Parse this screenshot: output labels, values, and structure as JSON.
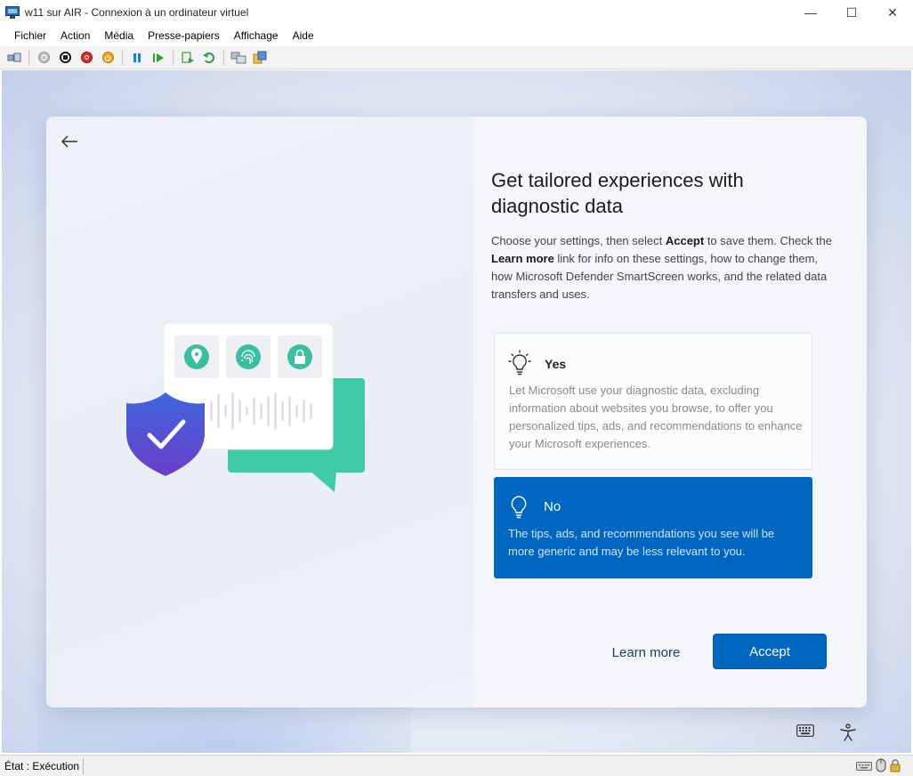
{
  "window": {
    "title": "w11 sur AIR - Connexion à un ordinateur virtuel",
    "minimize_glyph": "—",
    "maximize_glyph": "☐",
    "close_glyph": "✕"
  },
  "menubar": {
    "items": [
      {
        "label": "Fichier"
      },
      {
        "label": "Action"
      },
      {
        "label": "Média"
      },
      {
        "label": "Presse-papiers"
      },
      {
        "label": "Affichage"
      },
      {
        "label": "Aide"
      }
    ]
  },
  "toolbar": {
    "icons": [
      "ctrl-alt-del-icon",
      "start-icon",
      "turn-off-icon",
      "shutdown-icon",
      "save-icon",
      "pause-icon",
      "resume-icon",
      "checkpoint-icon",
      "revert-icon",
      "enhanced-session-icon",
      "share-icon"
    ]
  },
  "oobe": {
    "heading": "Get tailored experiences with diagnostic data",
    "desc_part1": "Choose your settings, then select ",
    "desc_accept": "Accept",
    "desc_part2": " to save them. Check the ",
    "desc_learn": "Learn more",
    "desc_part3": " link for info on these settings, how to change them, how Microsoft Defender SmartScreen works, and the related data transfers and uses.",
    "options": [
      {
        "title": "Yes",
        "body": "Let Microsoft use your diagnostic data, excluding information about websites you browse, to offer you personalized tips, ads, and recommendations to enhance your Microsoft experiences.",
        "selected": false
      },
      {
        "title": "No",
        "body": "The tips, ads, and recommendations you see will be more generic and may be less relevant to you.",
        "selected": true
      }
    ],
    "learn_more_label": "Learn more",
    "accept_label": "Accept"
  },
  "colors": {
    "accent": "#0067c0",
    "shield_top": "#3b5bdb",
    "shield_bottom": "#5f3dc4",
    "bubble": "#3ec9a7",
    "teal_icon": "#3bbfa0"
  },
  "statusbar": {
    "status": "État : Exécution"
  }
}
